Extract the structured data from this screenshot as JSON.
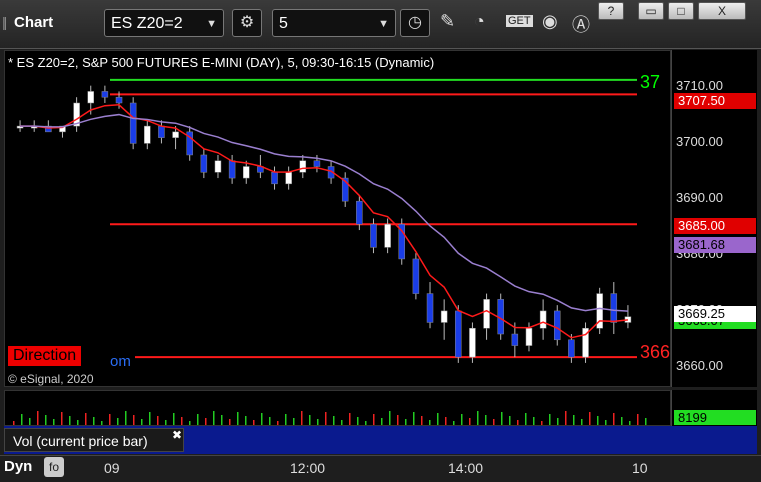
{
  "window": {
    "title": "Chart",
    "buttons": [
      "?",
      "▭",
      "□",
      "X"
    ]
  },
  "toolbar": {
    "symbol": "ES Z20=2",
    "interval": "5",
    "settings_icon": "gear-icon",
    "icons": [
      "clock-icon",
      "pencil-icon",
      "studies-icon",
      "get-icon",
      "play-icon",
      "alert-icon"
    ]
  },
  "chart": {
    "info": "* ES Z20=2, S&P 500 FUTURES E-MINI (DAY), 5, 09:30-16:15 (Dynamic)",
    "direction_label": "Direction",
    "direction_suffix": "om",
    "copyright": "© eSignal, 2020",
    "right_label_green": "37",
    "right_label_red": "366",
    "y_ticks": [
      "3710.00",
      "3700.00",
      "3690.00",
      "3680.00",
      "3670.00",
      "3660.00"
    ],
    "price_tags": [
      {
        "text": "3707.50",
        "bg": "#e00000",
        "color": "#ffffff"
      },
      {
        "text": "3685.00",
        "bg": "#e00000",
        "color": "#ffffff"
      },
      {
        "text": "3681.68",
        "bg": "#9a66cc",
        "color": "#000000"
      },
      {
        "text": "3669.25",
        "bg": "#ffffff",
        "color": "#000000"
      },
      {
        "text": "3668.07",
        "bg": "#22dd22",
        "color": "#000000"
      }
    ],
    "x_ticks": [
      "09",
      "12:00",
      "14:00",
      "10"
    ],
    "colors": {
      "up": "#ffffff",
      "down": "#1a3de8",
      "ema_red": "#ff1a1a",
      "ma_purple": "#9a7fcf",
      "green": "#22dd22"
    }
  },
  "chart_data": {
    "type": "candlestick",
    "ylim": [
      3657,
      3715
    ],
    "levels": [
      {
        "value": 3710.0,
        "color": "green"
      },
      {
        "value": 3707.5,
        "color": "red"
      },
      {
        "value": 3685.0,
        "color": "red"
      },
      {
        "value": 3662.0,
        "color": "red"
      }
    ],
    "candles": [
      [
        3702,
        3703,
        3701,
        3702
      ],
      [
        3702,
        3703,
        3701,
        3702
      ],
      [
        3702,
        3703,
        3701,
        3701
      ],
      [
        3701,
        3702,
        3700,
        3702
      ],
      [
        3702,
        3707,
        3701,
        3706
      ],
      [
        3706,
        3709,
        3704,
        3708
      ],
      [
        3708,
        3709,
        3706,
        3707
      ],
      [
        3707,
        3708,
        3705,
        3706
      ],
      [
        3706,
        3707,
        3698,
        3699
      ],
      [
        3699,
        3703,
        3698,
        3702
      ],
      [
        3702,
        3703,
        3699,
        3700
      ],
      [
        3700,
        3702,
        3698,
        3701
      ],
      [
        3701,
        3702,
        3696,
        3697
      ],
      [
        3697,
        3698,
        3693,
        3694
      ],
      [
        3694,
        3697,
        3693,
        3696
      ],
      [
        3696,
        3697,
        3692,
        3693
      ],
      [
        3693,
        3696,
        3692,
        3695
      ],
      [
        3695,
        3697,
        3693,
        3694
      ],
      [
        3694,
        3695,
        3691,
        3692
      ],
      [
        3692,
        3695,
        3691,
        3694
      ],
      [
        3694,
        3697,
        3693,
        3696
      ],
      [
        3696,
        3697,
        3694,
        3695
      ],
      [
        3695,
        3696,
        3692,
        3693
      ],
      [
        3693,
        3694,
        3688,
        3689
      ],
      [
        3689,
        3690,
        3684,
        3685
      ],
      [
        3685,
        3686,
        3680,
        3681
      ],
      [
        3681,
        3686,
        3680,
        3685
      ],
      [
        3685,
        3686,
        3678,
        3679
      ],
      [
        3679,
        3680,
        3672,
        3673
      ],
      [
        3673,
        3675,
        3667,
        3668
      ],
      [
        3668,
        3672,
        3665,
        3670
      ],
      [
        3670,
        3671,
        3661,
        3662
      ],
      [
        3662,
        3668,
        3661,
        3667
      ],
      [
        3667,
        3673,
        3665,
        3672
      ],
      [
        3672,
        3673,
        3665,
        3666
      ],
      [
        3666,
        3668,
        3662,
        3664
      ],
      [
        3664,
        3668,
        3663,
        3667
      ],
      [
        3667,
        3672,
        3665,
        3670
      ],
      [
        3670,
        3671,
        3664,
        3665
      ],
      [
        3665,
        3666,
        3661,
        3662
      ],
      [
        3662,
        3668,
        3661,
        3667
      ],
      [
        3667,
        3674,
        3666,
        3673
      ],
      [
        3673,
        3675,
        3666,
        3668
      ],
      [
        3668,
        3671,
        3667,
        3669
      ]
    ],
    "volume": {
      "label": "Vol (current price bar)",
      "value": "8199"
    }
  }
}
